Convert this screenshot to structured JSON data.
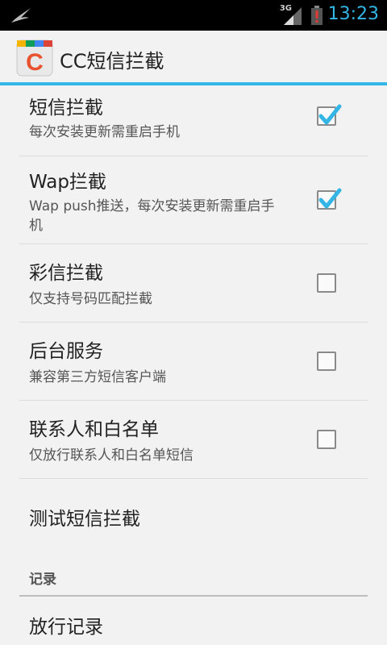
{
  "status_bar": {
    "network": "3G",
    "time": "13:23",
    "notification_icon": "swallow-icon",
    "battery_icon": "battery-alert-icon",
    "accent_color": "#33b5e5"
  },
  "action_bar": {
    "app_icon_letter": "C",
    "title": "CC短信拦截"
  },
  "preferences": [
    {
      "title": "短信拦截",
      "summary": "每次安装更新需重启手机",
      "checked": true
    },
    {
      "title": "Wap拦截",
      "summary": "Wap push推送，每次安装更新需重启手机",
      "checked": true
    },
    {
      "title": "彩信拦截",
      "summary": "仅支持号码匹配拦截",
      "checked": false
    },
    {
      "title": "后台服务",
      "summary": "兼容第三方短信客户端",
      "checked": false
    },
    {
      "title": "联系人和白名单",
      "summary": "仅放行联系人和白名单短信",
      "checked": false
    }
  ],
  "test_item": {
    "title": "测试短信拦截"
  },
  "category": {
    "label": "记录"
  },
  "records": [
    {
      "title": "放行记录"
    }
  ]
}
